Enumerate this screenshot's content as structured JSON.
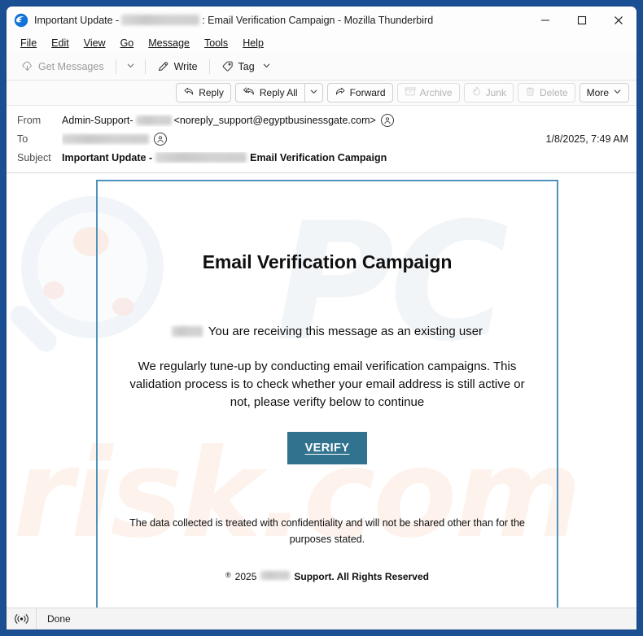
{
  "window": {
    "app_icon": "thunderbird-icon",
    "title_prefix": "Important Update - ",
    "title_suffix": ": Email Verification Campaign - Mozilla Thunderbird",
    "minimize_label": "Minimize",
    "maximize_label": "Maximize",
    "close_label": "Close"
  },
  "menubar": {
    "items": [
      {
        "label": "File",
        "accel": "F"
      },
      {
        "label": "Edit",
        "accel": "E"
      },
      {
        "label": "View",
        "accel": "V"
      },
      {
        "label": "Go",
        "accel": "G"
      },
      {
        "label": "Message",
        "accel": "M"
      },
      {
        "label": "Tools",
        "accel": "T"
      },
      {
        "label": "Help",
        "accel": "H"
      }
    ]
  },
  "toolbar": {
    "get_messages_label": "Get Messages",
    "get_messages_icon": "download-cloud-icon",
    "get_messages_chevron": "chevron-down-icon",
    "write_label": "Write",
    "write_icon": "pencil-icon",
    "tag_label": "Tag",
    "tag_icon": "tag-icon",
    "tag_chevron": "chevron-down-icon"
  },
  "message_actions": {
    "reply_label": "Reply",
    "reply_icon": "reply-arrow-icon",
    "reply_all_label": "Reply All",
    "reply_all_icon": "reply-all-arrow-icon",
    "reply_all_chevron": "chevron-down-icon",
    "forward_label": "Forward",
    "forward_icon": "forward-arrow-icon",
    "archive_label": "Archive",
    "archive_icon": "archive-box-icon",
    "junk_label": "Junk",
    "junk_icon": "flame-icon",
    "delete_label": "Delete",
    "delete_icon": "trash-icon",
    "more_label": "More",
    "more_chevron": "chevron-down-icon"
  },
  "headers": {
    "from_label": "From",
    "from_name_prefix": "Admin-Support-",
    "from_name_redacted": true,
    "from_address": "<noreply_support@egyptbusinessgate.com>",
    "from_badge_icon": "contact-circle-icon",
    "to_label": "To",
    "to_value_redacted": true,
    "to_badge_icon": "contact-circle-icon",
    "subject_label": "Subject",
    "subject_prefix": "Important Update - ",
    "subject_redacted": true,
    "subject_suffix": "Email Verification Campaign",
    "date": "1/8/2025, 7:49 AM"
  },
  "email": {
    "border_color": "#4f91bb",
    "title": "Email Verification Campaign",
    "greeting_redacted": true,
    "greeting": "You are receiving this message as an existing user",
    "paragraph": "We regularly tune-up by conducting email verification campaigns. This validation process is to check whether your email address is still active or not, please verifty below to continue",
    "verify_button_label": "VERIFY",
    "verify_button_color": "#31738f",
    "footer": "The data collected is treated with confidentiality and will not be shared  other  than for the purposes stated.",
    "copyright_symbol": "®",
    "copyright_year": "2025",
    "copyright_brand_redacted": true,
    "copyright_rest": "Support. All Rights Reserved",
    "watermark_text_primary": "PC",
    "watermark_text_secondary": "risk.com",
    "watermark_icon": "magnifying-glass-icon"
  },
  "statusbar": {
    "icon": "broadcast-icon",
    "text": "Done"
  }
}
